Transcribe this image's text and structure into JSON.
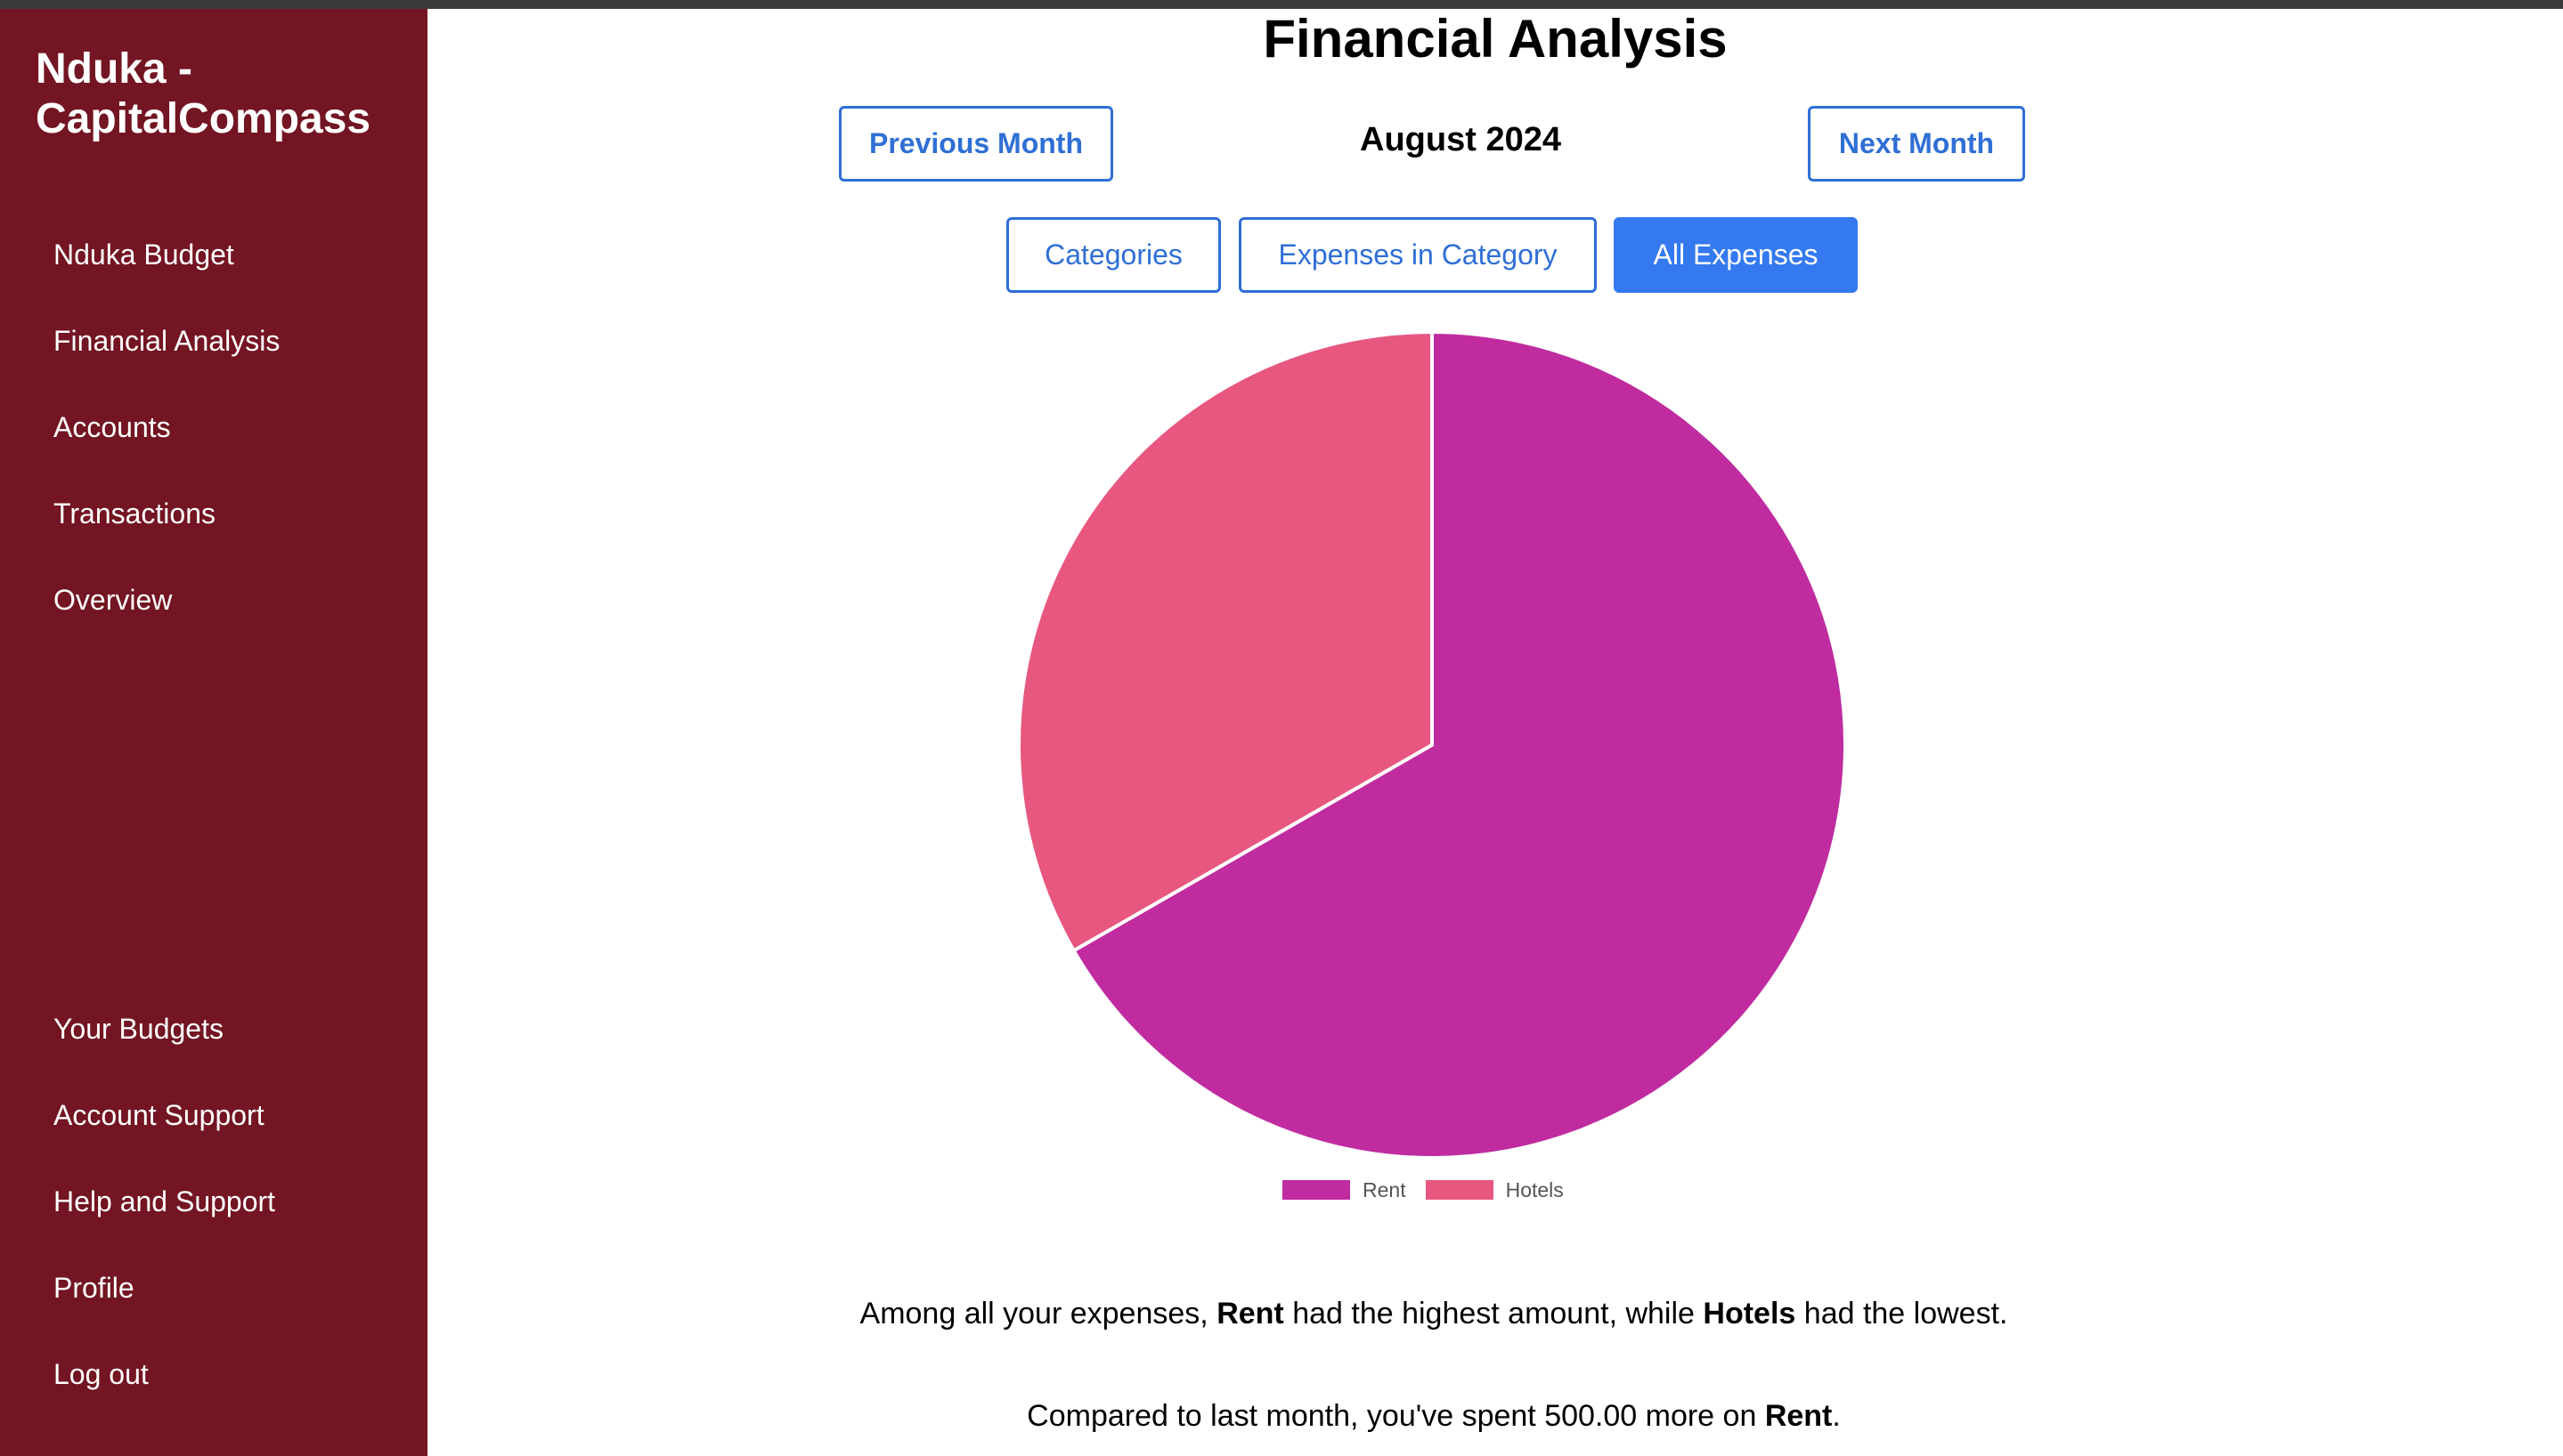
{
  "sidebar": {
    "brand": "Nduka - CapitalCompass",
    "top_items": [
      {
        "label": "Nduka Budget"
      },
      {
        "label": "Financial Analysis"
      },
      {
        "label": "Accounts"
      },
      {
        "label": "Transactions"
      },
      {
        "label": "Overview"
      }
    ],
    "bottom_items": [
      {
        "label": "Your Budgets"
      },
      {
        "label": "Account Support"
      },
      {
        "label": "Help and Support"
      },
      {
        "label": "Profile"
      },
      {
        "label": "Log out"
      }
    ],
    "background_color": "#731522"
  },
  "main": {
    "title": "Financial Analysis",
    "month_nav": {
      "previous_label": "Previous Month",
      "current_month": "August 2024",
      "next_label": "Next Month"
    },
    "view_tabs": [
      {
        "label": "Categories",
        "active": false
      },
      {
        "label": "Expenses in Category",
        "active": false
      },
      {
        "label": "All Expenses",
        "active": true
      }
    ],
    "accent_color": "#3479f0",
    "summary": {
      "line1_prefix": "Among all your expenses,",
      "line1_highest": "Rent",
      "line1_middle": "had the highest amount, while",
      "line1_lowest": "Hotels",
      "line1_suffix": "had the lowest.",
      "line2_prefix": "Compared to last month, you've spent 500.00 more on",
      "line2_category": "Rent",
      "line2_suffix": "."
    }
  },
  "chart_data": {
    "type": "pie",
    "categories": [
      "Rent",
      "Hotels"
    ],
    "values": [
      66.7,
      33.3
    ],
    "unit": "percent of total",
    "colors": [
      "#c02ca0",
      "#e75780"
    ],
    "legend_position": "bottom"
  }
}
